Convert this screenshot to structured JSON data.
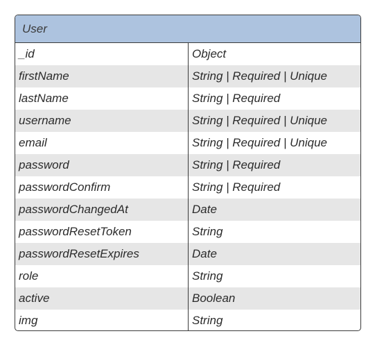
{
  "entity": {
    "title": "User",
    "header_color": "#adc3df",
    "fields": [
      {
        "name": "_id",
        "type": "Object"
      },
      {
        "name": "firstName",
        "type": "String | Required | Unique"
      },
      {
        "name": "lastName",
        "type": "String | Required"
      },
      {
        "name": "username",
        "type": "String | Required | Unique"
      },
      {
        "name": "email",
        "type": "String | Required | Unique"
      },
      {
        "name": "password",
        "type": "String | Required"
      },
      {
        "name": "passwordConfirm",
        "type": "String | Required"
      },
      {
        "name": "passwordChangedAt",
        "type": "Date"
      },
      {
        "name": "passwordResetToken",
        "type": "String"
      },
      {
        "name": "passwordResetExpires",
        "type": "Date"
      },
      {
        "name": "role",
        "type": "String"
      },
      {
        "name": "active",
        "type": "Boolean"
      },
      {
        "name": "img",
        "type": "String"
      }
    ]
  }
}
